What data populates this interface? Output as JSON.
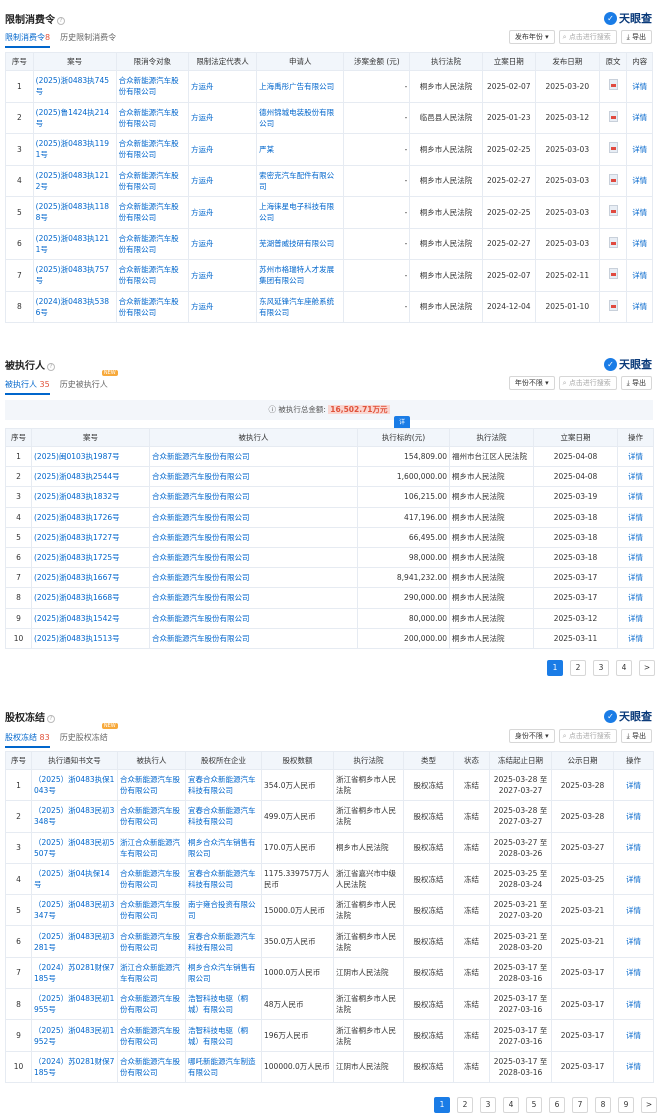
{
  "logo": "天眼查",
  "s1": {
    "title": "限制消费令",
    "tab1": "限制消费令",
    "tab1_count": "8",
    "tab2": "历史限制消费令",
    "filter": "发布年份 ▾",
    "search_placeholder": "点击进行搜索",
    "export": "导出",
    "headers": [
      "序号",
      "案号",
      "限消令对象",
      "限制法定代表人",
      "申请人",
      "涉案金额 (元)",
      "执行法院",
      "立案日期",
      "发布日期",
      "原文",
      "内容"
    ],
    "rows": [
      [
        "1",
        "(2025)浙0483执745号",
        "合众新能源汽车股份有限公司",
        "方运舟",
        "上海禹彤广告有限公司",
        "-",
        "桐乡市人民法院",
        "2025-02-07",
        "2025-03-20",
        "",
        "详情"
      ],
      [
        "2",
        "(2025)鲁1424执214号",
        "合众新能源汽车股份有限公司",
        "方运舟",
        "德州锦城电装股份有限公司",
        "-",
        "临邑县人民法院",
        "2025-01-23",
        "2025-03-12",
        "",
        "详情"
      ],
      [
        "3",
        "(2025)浙0483执1191号",
        "合众新能源汽车股份有限公司",
        "方运舟",
        "严某",
        "-",
        "桐乡市人民法院",
        "2025-02-25",
        "2025-03-03",
        "",
        "详情"
      ],
      [
        "4",
        "(2025)浙0483执1212号",
        "合众新能源汽车股份有限公司",
        "方运舟",
        "索密克汽车配件有限公司",
        "-",
        "桐乡市人民法院",
        "2025-02-27",
        "2025-03-03",
        "",
        "详情"
      ],
      [
        "5",
        "(2025)浙0483执1188号",
        "合众新能源汽车股份有限公司",
        "方运舟",
        "上海徕星电子科技有限公司",
        "-",
        "桐乡市人民法院",
        "2025-02-25",
        "2025-03-03",
        "",
        "详情"
      ],
      [
        "6",
        "(2025)浙0483执1211号",
        "合众新能源汽车股份有限公司",
        "方运舟",
        "芜湖普威技研有限公司",
        "-",
        "桐乡市人民法院",
        "2025-02-27",
        "2025-03-03",
        "",
        "详情"
      ],
      [
        "7",
        "(2025)浙0483执757号",
        "合众新能源汽车股份有限公司",
        "方运舟",
        "苏州市格瑞特人才发展集团有限公司",
        "-",
        "桐乡市人民法院",
        "2025-02-07",
        "2025-02-11",
        "",
        "详情"
      ],
      [
        "8",
        "(2024)浙0483执5386号",
        "合众新能源汽车股份有限公司",
        "方运舟",
        "东风延锋汽车座舱系统有限公司",
        "-",
        "桐乡市人民法院",
        "2024-12-04",
        "2025-01-10",
        "",
        "详情"
      ]
    ]
  },
  "s2": {
    "title": "被执行人",
    "tab1": "被执行人",
    "tab1_count": "35",
    "tab2": "历史被执行人",
    "new_badge": "NEW",
    "filter": "年份不限 ▾",
    "search_placeholder": "点击进行搜索",
    "export": "导出",
    "sum_label": "被执行总金额:",
    "sum_value": "16,502.71万元",
    "tip": "详",
    "headers": [
      "序号",
      "案号",
      "被执行人",
      "执行标的(元)",
      "执行法院",
      "立案日期",
      "操作"
    ],
    "rows": [
      [
        "1",
        "(2025)闽0103执1987号",
        "合众新能源汽车股份有限公司",
        "154,809.00",
        "福州市台江区人民法院",
        "2025-04-08",
        "详情"
      ],
      [
        "2",
        "(2025)浙0483执2544号",
        "合众新能源汽车股份有限公司",
        "1,600,000.00",
        "桐乡市人民法院",
        "2025-04-08",
        "详情"
      ],
      [
        "3",
        "(2025)浙0483执1832号",
        "合众新能源汽车股份有限公司",
        "106,215.00",
        "桐乡市人民法院",
        "2025-03-19",
        "详情"
      ],
      [
        "4",
        "(2025)浙0483执1726号",
        "合众新能源汽车股份有限公司",
        "417,196.00",
        "桐乡市人民法院",
        "2025-03-18",
        "详情"
      ],
      [
        "5",
        "(2025)浙0483执1727号",
        "合众新能源汽车股份有限公司",
        "66,495.00",
        "桐乡市人民法院",
        "2025-03-18",
        "详情"
      ],
      [
        "6",
        "(2025)浙0483执1725号",
        "合众新能源汽车股份有限公司",
        "98,000.00",
        "桐乡市人民法院",
        "2025-03-18",
        "详情"
      ],
      [
        "7",
        "(2025)浙0483执1667号",
        "合众新能源汽车股份有限公司",
        "8,941,232.00",
        "桐乡市人民法院",
        "2025-03-17",
        "详情"
      ],
      [
        "8",
        "(2025)浙0483执1668号",
        "合众新能源汽车股份有限公司",
        "290,000.00",
        "桐乡市人民法院",
        "2025-03-17",
        "详情"
      ],
      [
        "9",
        "(2025)浙0483执1542号",
        "合众新能源汽车股份有限公司",
        "80,000.00",
        "桐乡市人民法院",
        "2025-03-12",
        "详情"
      ],
      [
        "10",
        "(2025)浙0483执1513号",
        "合众新能源汽车股份有限公司",
        "200,000.00",
        "桐乡市人民法院",
        "2025-03-11",
        "详情"
      ]
    ],
    "pages": [
      "1",
      "2",
      "3",
      "4",
      ">"
    ]
  },
  "s3": {
    "title": "股权冻结",
    "tab1": "股权冻结",
    "tab1_count": "83",
    "tab2": "历史股权冻结",
    "new_badge": "NEW",
    "filter": "身份不限 ▾",
    "search_placeholder": "点击进行搜索",
    "export": "导出",
    "headers": [
      "序号",
      "执行通知书文号",
      "被执行人",
      "股权所在企业",
      "股权数额",
      "执行法院",
      "类型",
      "状态",
      "冻结起止日期",
      "公示日期",
      "操作"
    ],
    "rows": [
      [
        "1",
        "（2025）浙0483执保1043号",
        "合众新能源汽车股份有限公司",
        "宜春合众新能源汽车科技有限公司",
        "354.0万人民币",
        "浙江省桐乡市人民法院",
        "股权冻结",
        "冻结",
        "2025-03-28 至 2027-03-27",
        "2025-03-28",
        "详情"
      ],
      [
        "2",
        "（2025）浙0483民初3348号",
        "合众新能源汽车股份有限公司",
        "宜春合众新能源汽车科技有限公司",
        "499.0万人民币",
        "浙江省桐乡市人民法院",
        "股权冻结",
        "冻结",
        "2025-03-28 至 2027-03-27",
        "2025-03-28",
        "详情"
      ],
      [
        "3",
        "（2025）浙0483民初5507号",
        "浙江合众新能源汽车有限公司",
        "桐乡合众汽车销售有限公司",
        "170.0万人民币",
        "桐乡市人民法院",
        "股权冻结",
        "冻结",
        "2025-03-27 至 2028-03-26",
        "2025-03-27",
        "详情"
      ],
      [
        "4",
        "（2025）浙04执保14号",
        "合众新能源汽车股份有限公司",
        "宜春合众新能源汽车科技有限公司",
        "1175.339757万人民币",
        "浙江省嘉兴市中级人民法院",
        "股权冻结",
        "冻结",
        "2025-03-25 至 2028-03-24",
        "2025-03-25",
        "详情"
      ],
      [
        "5",
        "（2025）浙0483民初3347号",
        "合众新能源汽车股份有限公司",
        "南宁雍合投资有限公司",
        "15000.0万人民币",
        "浙江省桐乡市人民法院",
        "股权冻结",
        "冻结",
        "2025-03-21 至 2027-03-20",
        "2025-03-21",
        "详情"
      ],
      [
        "6",
        "（2025）浙0483民初3281号",
        "合众新能源汽车股份有限公司",
        "宜春合众新能源汽车科技有限公司",
        "350.0万人民币",
        "浙江省桐乡市人民法院",
        "股权冻结",
        "冻结",
        "2025-03-21 至 2028-03-20",
        "2025-03-21",
        "详情"
      ],
      [
        "7",
        "（2024）苏0281财保7185号",
        "浙江合众新能源汽车有限公司",
        "桐乡合众汽车销售有限公司",
        "1000.0万人民币",
        "江阴市人民法院",
        "股权冻结",
        "冻结",
        "2025-03-17 至 2028-03-16",
        "2025-03-17",
        "详情"
      ],
      [
        "8",
        "（2025）浙0483民初1955号",
        "合众新能源汽车股份有限公司",
        "浩智科技电驱（桐城）有限公司",
        "48万人民币",
        "浙江省桐乡市人民法院",
        "股权冻结",
        "冻结",
        "2025-03-17 至 2027-03-16",
        "2025-03-17",
        "详情"
      ],
      [
        "9",
        "（2025）浙0483民初1952号",
        "合众新能源汽车股份有限公司",
        "浩智科技电驱（桐城）有限公司",
        "196万人民币",
        "浙江省桐乡市人民法院",
        "股权冻结",
        "冻结",
        "2025-03-17 至 2027-03-16",
        "2025-03-17",
        "详情"
      ],
      [
        "10",
        "（2024）苏0281财保7185号",
        "合众新能源汽车股份有限公司",
        "哪吒新能源汽车制造有限公司",
        "100000.0万人民币",
        "江阴市人民法院",
        "股权冻结",
        "冻结",
        "2025-03-17 至 2028-03-16",
        "2025-03-17",
        "详情"
      ]
    ],
    "pages": [
      "1",
      "2",
      "3",
      "4",
      "5",
      "6",
      "7",
      "8",
      "9",
      ">"
    ]
  }
}
